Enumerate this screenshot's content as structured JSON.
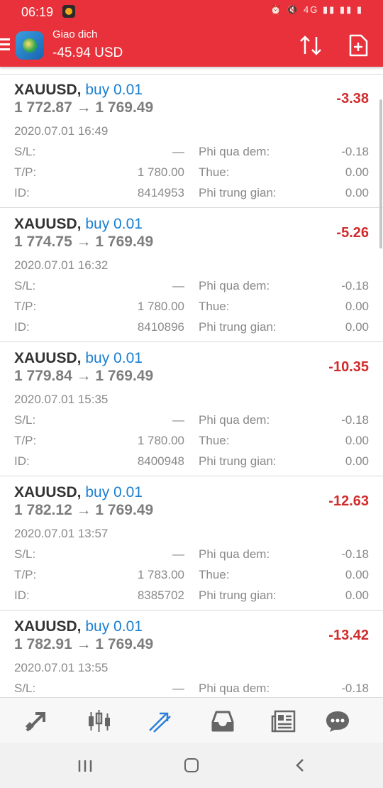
{
  "status_bar": {
    "time": "06:19",
    "right_icons": "⏰ 🔇 4G ▮▮ ▮▮ ▮"
  },
  "header": {
    "title": "Giao dich",
    "profit": "-45.94 USD"
  },
  "trades": [
    {
      "symbol": "XAUUSD,",
      "side": "buy 0.01",
      "prices": "1 772.87 → 1 769.49",
      "profit": "-3.38",
      "time": "2020.07.01 16:49",
      "sl_label": "S/L:",
      "sl": "—",
      "tp_label": "T/P:",
      "tp": "1 780.00",
      "id_label": "ID:",
      "id": "8414953",
      "swap_label": "Phi qua dem:",
      "swap": "-0.18",
      "tax_label": "Thue:",
      "tax": "0.00",
      "comm_label": "Phi trung gian:",
      "comm": "0.00"
    },
    {
      "symbol": "XAUUSD,",
      "side": "buy 0.01",
      "prices": "1 774.75 → 1 769.49",
      "profit": "-5.26",
      "time": "2020.07.01 16:32",
      "sl_label": "S/L:",
      "sl": "—",
      "tp_label": "T/P:",
      "tp": "1 780.00",
      "id_label": "ID:",
      "id": "8410896",
      "swap_label": "Phi qua dem:",
      "swap": "-0.18",
      "tax_label": "Thue:",
      "tax": "0.00",
      "comm_label": "Phi trung gian:",
      "comm": "0.00"
    },
    {
      "symbol": "XAUUSD,",
      "side": "buy 0.01",
      "prices": "1 779.84 → 1 769.49",
      "profit": "-10.35",
      "time": "2020.07.01 15:35",
      "sl_label": "S/L:",
      "sl": "—",
      "tp_label": "T/P:",
      "tp": "1 780.00",
      "id_label": "ID:",
      "id": "8400948",
      "swap_label": "Phi qua dem:",
      "swap": "-0.18",
      "tax_label": "Thue:",
      "tax": "0.00",
      "comm_label": "Phi trung gian:",
      "comm": "0.00"
    },
    {
      "symbol": "XAUUSD,",
      "side": "buy 0.01",
      "prices": "1 782.12 → 1 769.49",
      "profit": "-12.63",
      "time": "2020.07.01 13:57",
      "sl_label": "S/L:",
      "sl": "—",
      "tp_label": "T/P:",
      "tp": "1 783.00",
      "id_label": "ID:",
      "id": "8385702",
      "swap_label": "Phi qua dem:",
      "swap": "-0.18",
      "tax_label": "Thue:",
      "tax": "0.00",
      "comm_label": "Phi trung gian:",
      "comm": "0.00"
    },
    {
      "symbol": "XAUUSD,",
      "side": "buy 0.01",
      "prices": "1 782.91 → 1 769.49",
      "profit": "-13.42",
      "time": "2020.07.01 13:55",
      "sl_label": "S/L:",
      "sl": "—",
      "tp_label": "",
      "tp": "",
      "id_label": "",
      "id": "",
      "swap_label": "Phi qua dem:",
      "swap": "-0.18",
      "tax_label": "",
      "tax": "",
      "comm_label": "",
      "comm": ""
    }
  ],
  "bottom_nav": [
    "quotes-icon",
    "chart-icon",
    "trade-icon",
    "history-icon",
    "news-icon",
    "chat-icon"
  ],
  "colors": {
    "accent": "#e8313a",
    "loss": "#d12c2c",
    "buy": "#1a7fd1",
    "active_tab": "#2b7fd6"
  }
}
